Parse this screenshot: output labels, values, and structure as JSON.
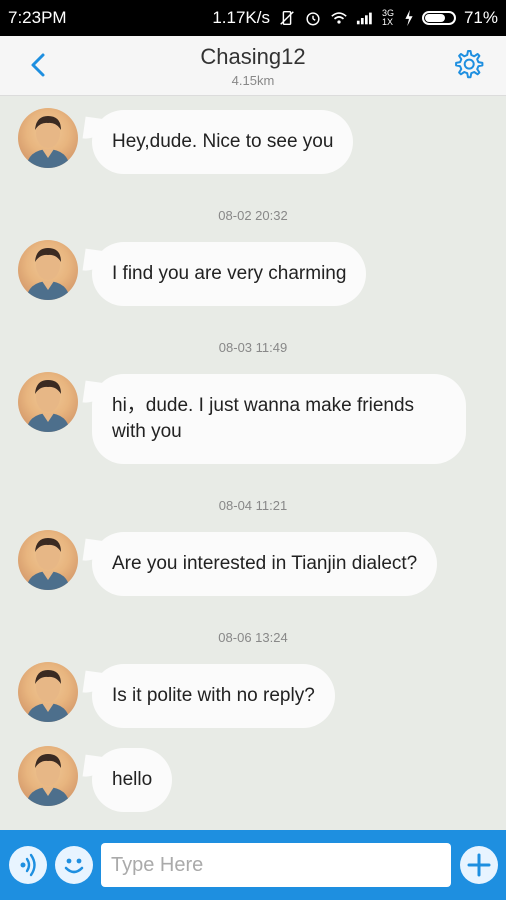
{
  "status_bar": {
    "time": "7:23PM",
    "speed": "1.17K/s",
    "network": "3G 1X",
    "battery": "71%",
    "battery_level": 0.71
  },
  "header": {
    "title": "Chasing12",
    "subtitle": "4.15km",
    "back_icon": "chevron-left-icon",
    "settings_icon": "gear-icon"
  },
  "messages": [
    {
      "text": "Hey,dude. Nice to see you"
    },
    {
      "timestamp": "08-02 20:32"
    },
    {
      "text": "I find you are very charming"
    },
    {
      "timestamp": "08-03 11:49"
    },
    {
      "text": "hi，dude. I just wanna make friends with you"
    },
    {
      "timestamp": "08-04 11:21"
    },
    {
      "text": "Are you interested in Tianjin dialect?"
    },
    {
      "timestamp": "08-06 13:24"
    },
    {
      "text": "Is it polite with no reply?"
    },
    {
      "text": "hello"
    }
  ],
  "input": {
    "placeholder": "Type Here",
    "voice_icon": "voice-icon",
    "emoji_icon": "emoji-icon",
    "add_icon": "plus-icon"
  },
  "colors": {
    "accent": "#1e8fe0",
    "chat_background": "#e8ebe6",
    "bubble": "#fbfbfb"
  }
}
